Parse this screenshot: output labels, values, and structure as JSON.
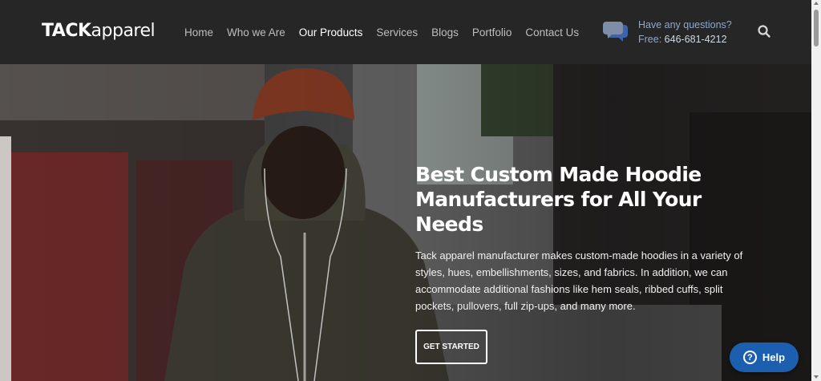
{
  "header": {
    "logo_bold": "TACK",
    "logo_light": "apparel",
    "nav": [
      {
        "label": "Home",
        "active": false
      },
      {
        "label": "Who we Are",
        "active": false
      },
      {
        "label": "Our Products",
        "active": true
      },
      {
        "label": "Services",
        "active": false
      },
      {
        "label": "Blogs",
        "active": false
      },
      {
        "label": "Portfolio",
        "active": false
      },
      {
        "label": "Contact Us",
        "active": false
      }
    ],
    "contact_question": "Have any questions?",
    "contact_free_label": "Free:",
    "contact_phone": "646-681-4212",
    "icons": {
      "chat": "chat-bubbles-icon",
      "search": "search-icon"
    }
  },
  "hero": {
    "title_line1": "Best Custom Made Hoodie",
    "title_line2": "Manufacturers for All Your Needs",
    "description": "Tack apparel manufacturer makes custom-made hoodies in a variety of styles, hues, embellishments, sizes, and fabrics. In addition, we can accommodate additional fashions like hem seals, ribbed cuffs, split pockets, pullovers, full zip-ups, and many more.",
    "cta_label": "GET STARTED"
  },
  "help": {
    "label": "Help",
    "icon": "question-icon"
  },
  "colors": {
    "header_bg": "#262626",
    "accent_blue": "#1c5fae",
    "nav_active": "#ffffff",
    "nav_inactive": "#bdbdbd"
  }
}
